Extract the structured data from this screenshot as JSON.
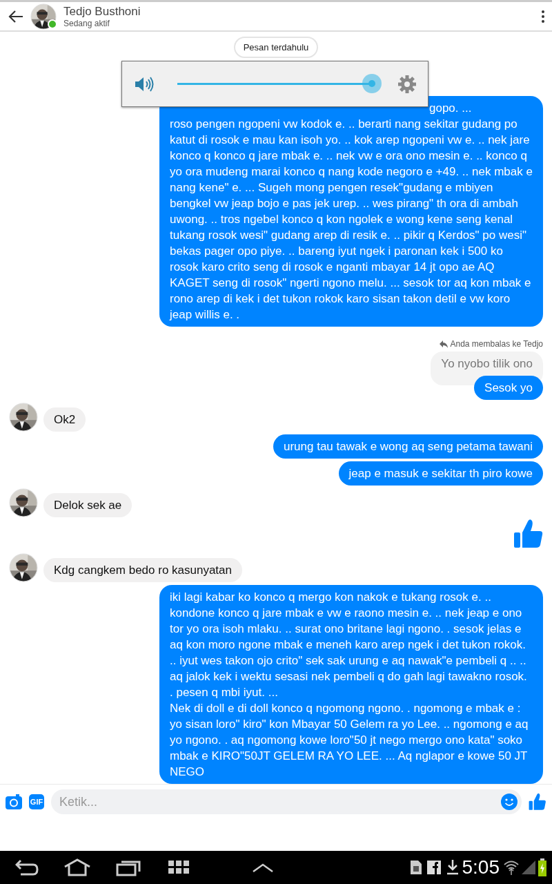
{
  "header": {
    "name": "Tedjo Busthoni",
    "status": "Sedang aktif",
    "online": true
  },
  "earlier_button": "Pesan terdahulu",
  "volume": {
    "level": 1.0
  },
  "messages": [
    {
      "kind": "sent",
      "fragment": "gopo. ...",
      "text": "roso pengen ngopeni vw kodok e. .. berarti nang sekitar gudang po katut di rosok e mau kan isoh yo. .. kok arep ngopeni vw e. .. nek jare konco q konco q jare mbak e. .. nek vw e ora ono mesin e. .. konco q yo ora mudeng marai konco q nang kode negoro e +49. .. nek mbak e nang kene\" e. ... Sugeh mong pengen resek\"gudang e mbiyen bengkel vw jeap bojo e pas jek urep. .. wes pirang\" th ora di ambah uwong. .. tros ngebel konco q kon ngolek e wong kene seng kenal tukang rosok wesi\" gudang arep di resik e. .. pikir q Kerdos\" po wesi\" bekas pager opo piye. .. bareng iyut ngek i paronan kek i 500 ko rosok karo crito seng di rosok e nganti mbayar 14 jt opo ae AQ KAGET seng di rosok\" ngerti ngono melu. ... sesok tor aq kon mbak e rono arep di kek i det tukon rokok karo sisan takon detil e vw koro jeap willis e. ."
    },
    {
      "kind": "reply_note",
      "text": "Anda membalas ke Tedjo"
    },
    {
      "kind": "quoted",
      "text": "Yo nyobo tilik ono"
    },
    {
      "kind": "sent",
      "text": "Sesok yo"
    },
    {
      "kind": "received",
      "text": "Ok2"
    },
    {
      "kind": "sent",
      "text": "urung tau tawak e wong aq seng petama tawani"
    },
    {
      "kind": "sent",
      "text": "jeap e masuk e sekitar th piro kowe"
    },
    {
      "kind": "received",
      "text": "Delok sek ae"
    },
    {
      "kind": "like"
    },
    {
      "kind": "received",
      "text": "Kdg cangkem bedo ro kasunyatan"
    },
    {
      "kind": "sent",
      "text": "iki lagi kabar ko konco q mergo kon nakok e tukang rosok e. .. kondone konco q jare mbak e vw e raono mesin e. .. nek jeap e ono tor yo ora isoh mlaku. .. surat ono britane lagi ngono. . sesok jelas e aq kon moro ngone mbak e meneh karo arep ngek i det tukon rokok. .. iyut wes takon ojo crito\" sek sak urung e aq nawak\"e pembeli q .. .. aq jalok kek i wektu sesasi nek pembeli q do gah lagi tawakno rosok. . pesen q mbi iyut. ...\nNek di doll e di doll konco q ngomong ngono. . ngomong e mbak e : yo sisan loro\" kiro\" kon Mbayar 50 Gelem ra yo Lee. .. ngomong e aq yo ngono. . aq ngomong kowe loro\"50 jt nego mergo ono kata\" soko mbak e KIRO\"50JT GELEM RA YO LEE. ... Aq nglapor e kowe 50 JT NEGO"
    }
  ],
  "composer": {
    "gif_label": "GIF",
    "placeholder": "Ketik..."
  },
  "status_bar": {
    "time": "5:05"
  }
}
